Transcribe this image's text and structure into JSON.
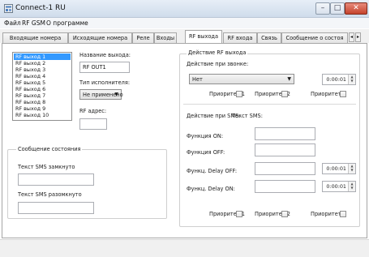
{
  "window": {
    "title": "Connect-1 RU",
    "icon": "app-icon"
  },
  "controls": {
    "minimize": "–",
    "maximize": "□",
    "close": "✕"
  },
  "menu": [
    "Файл",
    "RF GSM",
    "О программе"
  ],
  "tabs": [
    "Входящие номера",
    "Исходящие номера",
    "Реле",
    "Входы",
    "RF выхода",
    "RF входа",
    "Связь",
    "Сообщение о состоя"
  ],
  "active_tab": "RF выхода",
  "outputs_list": [
    "RF выход 1",
    "RF выход 2",
    "RF выход 3",
    "RF выход 4",
    "RF выход 5",
    "RF выход 6",
    "RF выход 7",
    "RF выход 8",
    "RF выход 9",
    "RF выход 10"
  ],
  "selected_output": "RF выход 1",
  "output_name": {
    "label": "Название выхода:",
    "value": "RF OUT1"
  },
  "executor_type": {
    "label": "Тип исполнителя:",
    "value": "Не применено"
  },
  "rf_address": {
    "label": "RF адрес:",
    "value": ""
  },
  "state_message": {
    "title": "Сообщение состояния",
    "closed_label": "Текст SMS замкнуто",
    "closed_value": "",
    "open_label": "Текст SMS разомкнуто",
    "open_value": ""
  },
  "rf_actions": {
    "title": "Действие RF выхода",
    "on_call_label": "Действие при звонке:",
    "on_call_value": "Нет",
    "on_call_time": "0:00:01",
    "priority1": "Приоритет 1",
    "priority2": "Приоритет 2",
    "priority3": "Приоритет 3",
    "on_sms_label": "Действие при SMS:",
    "sms_text_label": "Текст SMS:",
    "function_on_label": "Функция ON:",
    "function_on_value": "",
    "function_off_label": "Функция OFF:",
    "function_off_value": "",
    "delay_off_label": "Функц. Delay OFF:",
    "delay_off_value": "",
    "delay_off_time": "0:00:01",
    "delay_on_label": "Функц. Delay ON:",
    "delay_on_value": "",
    "delay_on_time": "0:00:01"
  },
  "colors": {
    "selection": "#3399ff",
    "close_button": "#c5432c",
    "title_bar": "#dbe5f1"
  }
}
